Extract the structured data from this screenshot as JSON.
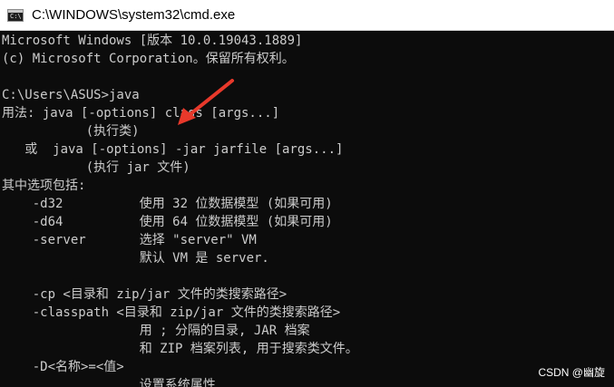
{
  "window": {
    "title": "C:\\WINDOWS\\system32\\cmd.exe",
    "icon": "cmd-icon",
    "icon_glyph": "C:\\"
  },
  "console": {
    "lines": [
      "Microsoft Windows [版本 10.0.19043.1889]",
      "(c) Microsoft Corporation。保留所有权利。",
      "",
      "C:\\Users\\ASUS>java",
      "用法: java [-options] class [args...]",
      "           (执行类)",
      "   或  java [-options] -jar jarfile [args...]",
      "           (执行 jar 文件)",
      "其中选项包括:",
      "    -d32          使用 32 位数据模型 (如果可用)",
      "    -d64          使用 64 位数据模型 (如果可用)",
      "    -server       选择 \"server\" VM",
      "                  默认 VM 是 server.",
      "",
      "    -cp <目录和 zip/jar 文件的类搜索路径>",
      "    -classpath <目录和 zip/jar 文件的类搜索路径>",
      "                  用 ; 分隔的目录, JAR 档案",
      "                  和 ZIP 档案列表, 用于搜索类文件。",
      "    -D<名称>=<值>",
      "                  设置系统属性"
    ]
  },
  "annotation": {
    "arrow_color": "#e8392b"
  },
  "watermark": {
    "text": "CSDN @幽旋"
  },
  "colors": {
    "console_bg": "#0c0c0c",
    "console_text": "#cccccc",
    "titlebar_bg": "#ffffff"
  }
}
